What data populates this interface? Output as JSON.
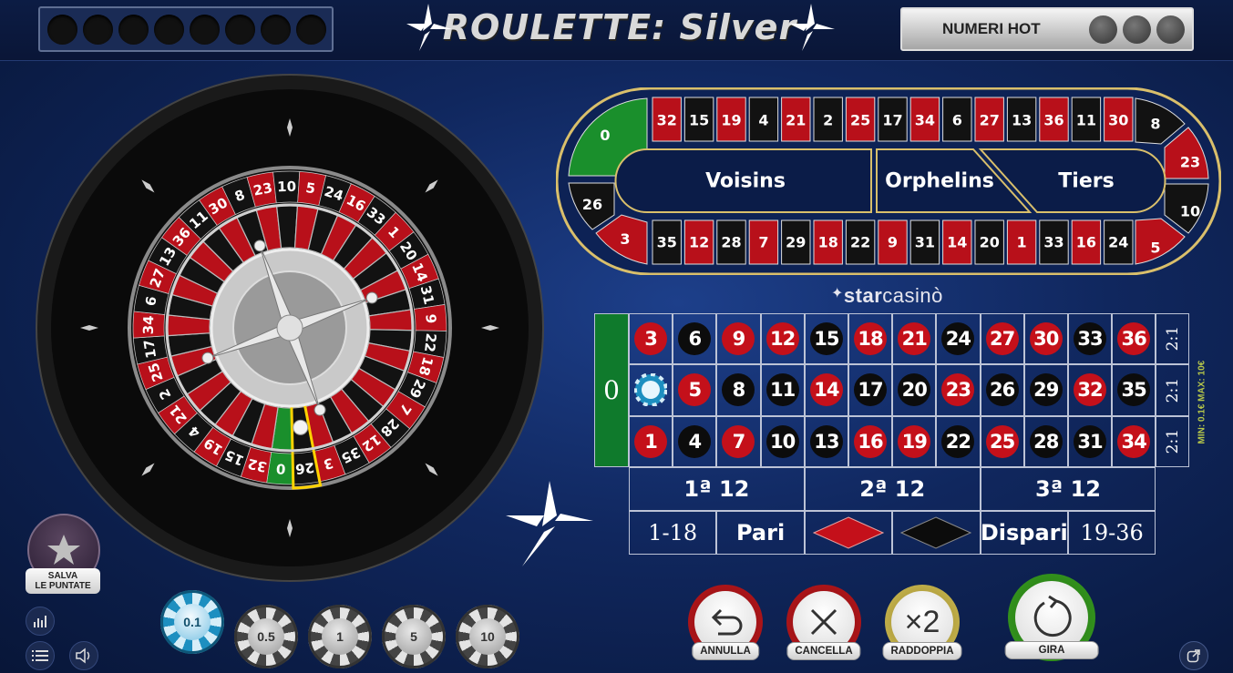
{
  "header": {
    "logo_text": "ROULETTE: Silver",
    "history_slots": 8,
    "hot_label": "NUMERI HOT",
    "hot_slots": 3
  },
  "wheel": {
    "sequence": [
      "0",
      "32",
      "15",
      "19",
      "4",
      "21",
      "2",
      "25",
      "17",
      "34",
      "6",
      "27",
      "13",
      "36",
      "11",
      "30",
      "8",
      "23",
      "10",
      "5",
      "24",
      "16",
      "33",
      "1",
      "20",
      "14",
      "31",
      "9",
      "22",
      "18",
      "29",
      "7",
      "28",
      "12",
      "35",
      "3",
      "26"
    ],
    "colors": {
      "red": "#b8101a",
      "black": "#121212",
      "green": "#1a8f2c"
    },
    "highlighted_number": "26"
  },
  "racetrack": {
    "top_row": [
      "32",
      "15",
      "19",
      "4",
      "21",
      "2",
      "25",
      "17",
      "34",
      "6",
      "27",
      "13",
      "36",
      "11",
      "30"
    ],
    "bottom_row": [
      "35",
      "12",
      "28",
      "7",
      "29",
      "18",
      "22",
      "9",
      "31",
      "14",
      "20",
      "1",
      "33",
      "16",
      "24"
    ],
    "left_cap": [
      "0",
      "26",
      "3"
    ],
    "right_cap": [
      "8",
      "23",
      "10",
      "5"
    ],
    "sections": {
      "voisins": "Voisins",
      "orphelins": "Orphelins",
      "tiers": "Tiers"
    }
  },
  "brand": {
    "star": "star",
    "casino": "casinò"
  },
  "limits": "MIN: 0.1€    MAX: 10€",
  "betting_table": {
    "zero": "0",
    "rows": [
      [
        "3",
        "6",
        "9",
        "12",
        "15",
        "18",
        "21",
        "24",
        "27",
        "30",
        "33",
        "36"
      ],
      [
        "2",
        "5",
        "8",
        "11",
        "14",
        "17",
        "20",
        "23",
        "26",
        "29",
        "32",
        "35"
      ],
      [
        "1",
        "4",
        "7",
        "10",
        "13",
        "16",
        "19",
        "22",
        "25",
        "28",
        "31",
        "34"
      ]
    ],
    "red_numbers": [
      "1",
      "3",
      "5",
      "7",
      "9",
      "12",
      "14",
      "16",
      "18",
      "19",
      "21",
      "23",
      "25",
      "27",
      "30",
      "32",
      "34",
      "36"
    ],
    "column_bets": [
      "2:1",
      "2:1",
      "2:1"
    ],
    "dozens": [
      "1ª 12",
      "2ª 12",
      "3ª 12"
    ],
    "outside": {
      "low": "1-18",
      "even": "Pari",
      "red_label": "red",
      "black_label": "black",
      "odd": "Dispari",
      "high": "19-36"
    },
    "chip_on": "2"
  },
  "left_panel": {
    "save_label_1": "SALVA",
    "save_label_2": "LE PUNTATE",
    "stats_icon": "bar-chart-icon",
    "menu_icon": "list-icon",
    "sound_icon": "speaker-icon"
  },
  "chips": [
    {
      "value": "0.1",
      "selected": true
    },
    {
      "value": "0.5",
      "selected": false
    },
    {
      "value": "1",
      "selected": false
    },
    {
      "value": "5",
      "selected": false
    },
    {
      "value": "10",
      "selected": false
    }
  ],
  "actions": {
    "undo": "ANNULLA",
    "clear": "CANCELLA",
    "double": "RADDOPPIA",
    "double_symbol": "×2",
    "spin": "GIRA"
  }
}
